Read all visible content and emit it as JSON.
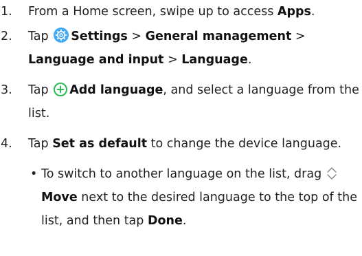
{
  "steps": [
    {
      "number": "1.",
      "text_before": "From a Home screen, swipe up to access ",
      "bold": "Apps",
      "text_after": "."
    },
    {
      "number": "2.",
      "tap": "Tap",
      "icon": "settings-gear-icon",
      "bold_1": "Settings",
      "sep_1": " > ",
      "bold_2": "General management",
      "sep_2": " >",
      "bold_3": "Language and input",
      "sep_3": " > ",
      "bold_4": "Language",
      "end": "."
    },
    {
      "number": "3.",
      "tap": "Tap",
      "icon": "add-plus-icon",
      "bold": "Add language",
      "text_after": ", and select a language from the list."
    },
    {
      "number": "4.",
      "tap": "Tap ",
      "bold": "Set as default",
      "text_after": " to change the device language."
    }
  ],
  "bullet": {
    "marker": "•",
    "text_before": "To switch to another language on the list, drag ",
    "icon": "move-up-down-icon",
    "bold_move": "Move",
    "text_middle": " next to the desired language to the top of the list, and then tap ",
    "bold_done": "Done",
    "end": "."
  },
  "colors": {
    "settings_icon": "#3fa9f5",
    "add_icon": "#2dbb58",
    "move_icon": "#8a8a8a"
  }
}
